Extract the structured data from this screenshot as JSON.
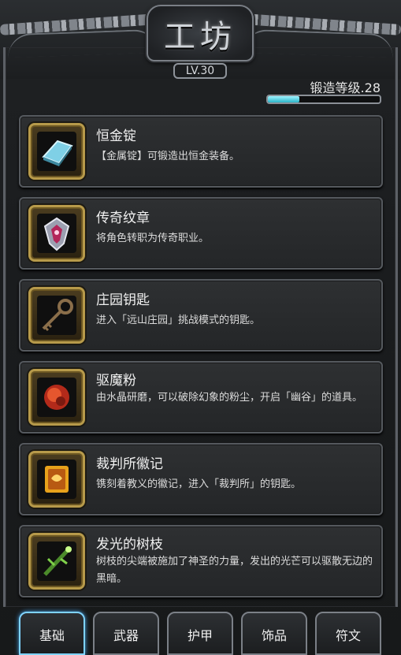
{
  "header": {
    "title": "工坊",
    "level_badge": "LV.30",
    "forge_level_label": "锻造等级.28",
    "forge_progress": 0.28
  },
  "items": [
    {
      "name": "恒金锭",
      "desc": "【金属锭】可锻造出恒金装备。",
      "icon": "ingot-icon"
    },
    {
      "name": "传奇纹章",
      "desc": "将角色转职为传奇职业。",
      "icon": "crest-icon"
    },
    {
      "name": "庄园钥匙",
      "desc": "进入「远山庄园」挑战模式的钥匙。",
      "icon": "key-icon"
    },
    {
      "name": "驱魔粉",
      "desc": "由水晶研磨，可以破除幻象的粉尘，开启「幽谷」的道具。",
      "icon": "powder-icon"
    },
    {
      "name": "裁判所徽记",
      "desc": "镌刻着教义的徽记，进入「裁判所」的钥匙。",
      "icon": "emblem-icon"
    },
    {
      "name": "发光的树枝",
      "desc": "树枝的尖端被施加了神圣的力量，发出的光芒可以驱散无边的黑暗。",
      "icon": "branch-icon"
    }
  ],
  "tabs": [
    {
      "label": "基础",
      "active": true
    },
    {
      "label": "武器",
      "active": false
    },
    {
      "label": "护甲",
      "active": false
    },
    {
      "label": "饰品",
      "active": false
    },
    {
      "label": "符文",
      "active": false
    }
  ],
  "colors": {
    "accent_tab": "#7fd3ff",
    "progress": "#2bb4c7",
    "icon_frame": "#b79a4a"
  }
}
